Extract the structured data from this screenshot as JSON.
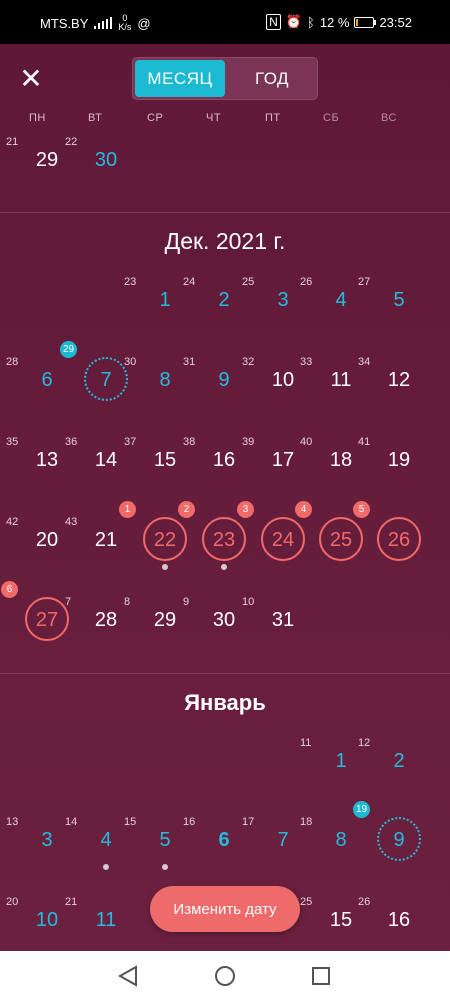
{
  "status": {
    "carrier": "MTS.BY",
    "speed_value": "0",
    "speed_unit": "K/s",
    "battery": "12 %",
    "battery_level": 12,
    "time": "23:52"
  },
  "header": {
    "close_label": "✕",
    "tabs": [
      {
        "label": "МЕСЯЦ",
        "active": true
      },
      {
        "label": "ГОД",
        "active": false
      }
    ]
  },
  "weekdays": [
    "ПН",
    "ВТ",
    "СР",
    "ЧТ",
    "ПТ",
    "СБ",
    "ВС"
  ],
  "colors": {
    "accent": "#1bb9d2",
    "period": "#f16a6a",
    "background": "#651c3b"
  },
  "prev_tail": [
    {
      "week": "21",
      "day": "29",
      "col": 0,
      "style": "normal"
    },
    {
      "week": "22",
      "day": "30",
      "col": 1,
      "style": "blue"
    }
  ],
  "months": [
    {
      "title": "Дек. 2021 г.",
      "rows": [
        [
          {
            "week": "23",
            "day": "1",
            "col": 2,
            "style": "blue"
          },
          {
            "week": "24",
            "day": "2",
            "col": 3,
            "style": "blue"
          },
          {
            "week": "25",
            "day": "3",
            "col": 4,
            "style": "blue"
          },
          {
            "week": "26",
            "day": "4",
            "col": 5,
            "style": "blue"
          },
          {
            "week": "27",
            "day": "5",
            "col": 6,
            "style": "blue"
          }
        ],
        [
          {
            "week": "28",
            "day": "6",
            "col": 0,
            "style": "blue"
          },
          {
            "week": "",
            "day": "7",
            "col": 1,
            "style": "blue",
            "ring": "dotted",
            "badge": "29",
            "badge_color": "blue"
          },
          {
            "week": "30",
            "day": "8",
            "col": 2,
            "style": "blue"
          },
          {
            "week": "31",
            "day": "9",
            "col": 3,
            "style": "blue"
          },
          {
            "week": "32",
            "day": "10",
            "col": 4,
            "style": "normal"
          },
          {
            "week": "33",
            "day": "11",
            "col": 5,
            "style": "normal"
          },
          {
            "week": "34",
            "day": "12",
            "col": 6,
            "style": "normal"
          }
        ],
        [
          {
            "week": "35",
            "day": "13",
            "col": 0,
            "style": "normal"
          },
          {
            "week": "36",
            "day": "14",
            "col": 1,
            "style": "normal"
          },
          {
            "week": "37",
            "day": "15",
            "col": 2,
            "style": "normal"
          },
          {
            "week": "38",
            "day": "16",
            "col": 3,
            "style": "normal"
          },
          {
            "week": "39",
            "day": "17",
            "col": 4,
            "style": "normal"
          },
          {
            "week": "40",
            "day": "18",
            "col": 5,
            "style": "normal"
          },
          {
            "week": "41",
            "day": "19",
            "col": 6,
            "style": "normal"
          }
        ],
        [
          {
            "week": "42",
            "day": "20",
            "col": 0,
            "style": "normal"
          },
          {
            "week": "43",
            "day": "21",
            "col": 1,
            "style": "normal"
          },
          {
            "week": "",
            "day": "22",
            "col": 2,
            "style": "red",
            "ring": "red",
            "badge": "1",
            "badge_color": "red",
            "dot": true
          },
          {
            "week": "",
            "day": "23",
            "col": 3,
            "style": "red",
            "ring": "red",
            "badge": "2",
            "badge_color": "red",
            "dot": true
          },
          {
            "week": "",
            "day": "24",
            "col": 4,
            "style": "red",
            "ring": "red",
            "badge": "3",
            "badge_color": "red"
          },
          {
            "week": "",
            "day": "25",
            "col": 5,
            "style": "red",
            "ring": "red",
            "badge": "4",
            "badge_color": "red"
          },
          {
            "week": "",
            "day": "26",
            "col": 6,
            "style": "red",
            "ring": "red",
            "badge": "5",
            "badge_color": "red"
          }
        ],
        [
          {
            "week": "",
            "day": "27",
            "col": 0,
            "style": "red",
            "ring": "red",
            "badge": "6",
            "badge_color": "red"
          },
          {
            "week": "7",
            "day": "28",
            "col": 1,
            "style": "normal"
          },
          {
            "week": "8",
            "day": "29",
            "col": 2,
            "style": "normal"
          },
          {
            "week": "9",
            "day": "30",
            "col": 3,
            "style": "normal"
          },
          {
            "week": "10",
            "day": "31",
            "col": 4,
            "style": "normal"
          }
        ]
      ]
    },
    {
      "title": "Январь",
      "rows": [
        [
          {
            "week": "11",
            "day": "1",
            "col": 5,
            "style": "blue"
          },
          {
            "week": "12",
            "day": "2",
            "col": 6,
            "style": "blue"
          }
        ],
        [
          {
            "week": "13",
            "day": "3",
            "col": 0,
            "style": "blue"
          },
          {
            "week": "14",
            "day": "4",
            "col": 1,
            "style": "blue",
            "dot": true
          },
          {
            "week": "15",
            "day": "5",
            "col": 2,
            "style": "blue",
            "dot": true
          },
          {
            "week": "16",
            "day": "6",
            "col": 3,
            "style": "today"
          },
          {
            "week": "17",
            "day": "7",
            "col": 4,
            "style": "blue"
          },
          {
            "week": "18",
            "day": "8",
            "col": 5,
            "style": "blue"
          },
          {
            "week": "",
            "day": "9",
            "col": 6,
            "style": "blue",
            "ring": "dotted",
            "badge": "19",
            "badge_color": "blue"
          }
        ],
        [
          {
            "week": "20",
            "day": "10",
            "col": 0,
            "style": "blue"
          },
          {
            "week": "21",
            "day": "11",
            "col": 1,
            "style": "blue"
          },
          {
            "week": "25",
            "day": "15",
            "col": 5,
            "style": "normal"
          },
          {
            "week": "26",
            "day": "16",
            "col": 6,
            "style": "normal"
          }
        ]
      ]
    }
  ],
  "fab": {
    "label": "Изменить дату"
  }
}
